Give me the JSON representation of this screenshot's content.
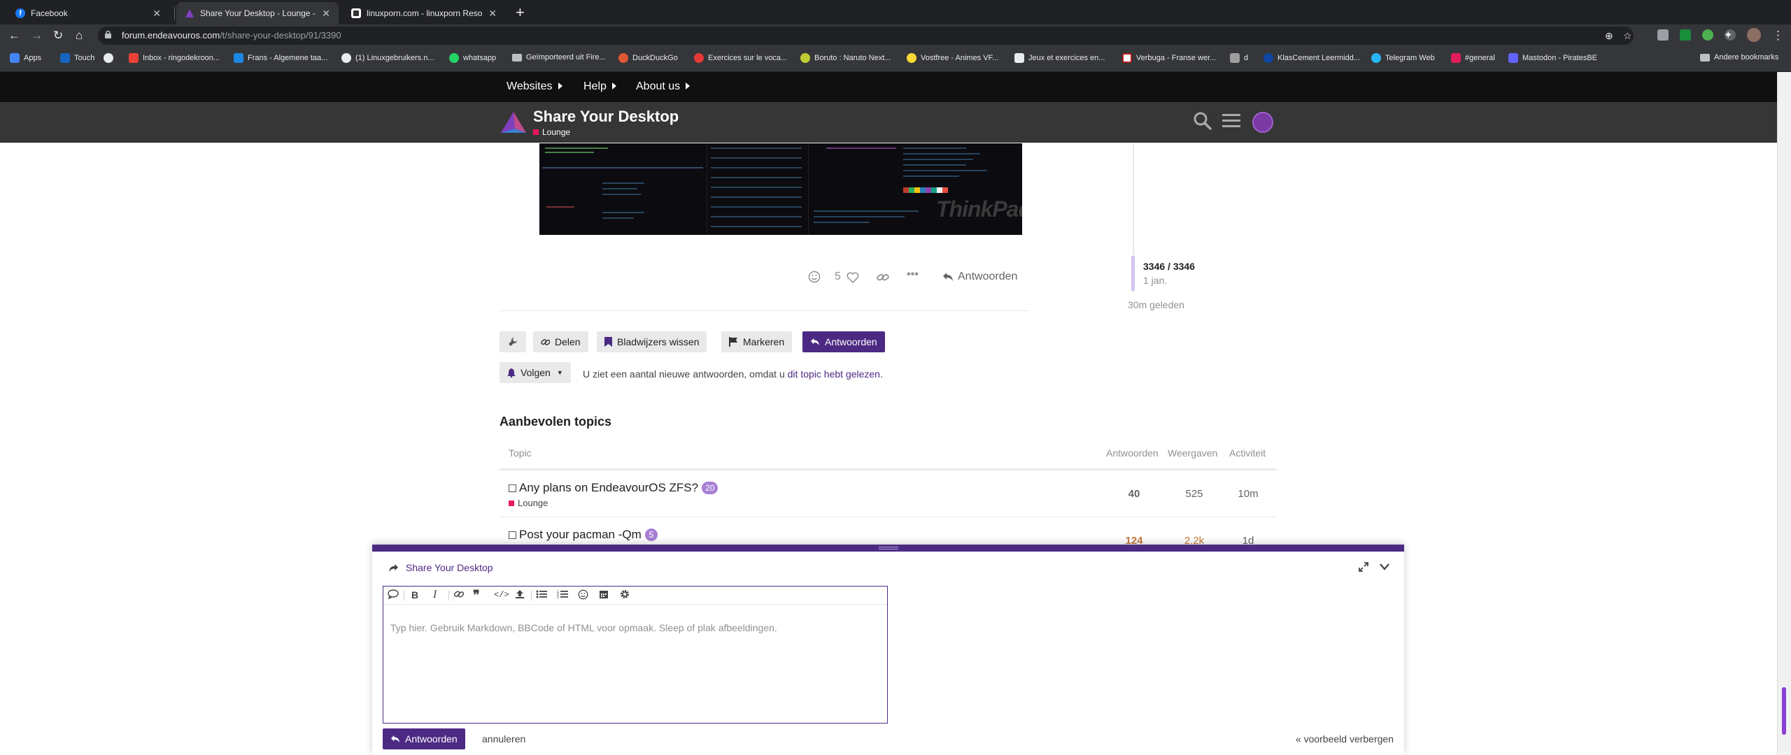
{
  "browser": {
    "tabs": [
      {
        "title": "Facebook",
        "active": false
      },
      {
        "title": "Share Your Desktop - Lounge - End",
        "active": true
      },
      {
        "title": "linuxporn.com - linuxporn Resource",
        "active": false
      }
    ],
    "url_domain": "forum.endeavouros.com",
    "url_path": "/t/share-your-desktop/91/3390",
    "bookmarks": [
      "Apps",
      "Touch",
      "",
      "Inbox - ringodekroon...",
      "Frans - Algemene taa...",
      "(1) Linuxgebruikers.n...",
      "whatsapp",
      "Geïmporteerd uit Fire...",
      "DuckDuckGo",
      "Exercices sur le voca...",
      "Boruto : Naruto Next...",
      "Vostfree - Animes VF...",
      "Jeux et exercices en...",
      "Verbuga - Franse wer...",
      "d",
      "KlasCement Leermidd...",
      "Telegram Web",
      "#general",
      "Mastodon - PiratesBE"
    ],
    "other_bookmarks": "Andere bookmarks"
  },
  "site": {
    "nav": [
      "Websites",
      "Help",
      "About us"
    ],
    "title": "Share Your Desktop",
    "category": "Lounge"
  },
  "post": {
    "likes": "5",
    "reply_label": "Antwoorden",
    "image_watermark": "ThinkPad"
  },
  "timeline": {
    "count": "3346 / 3346",
    "date": "1 jan.",
    "ago": "30m geleden"
  },
  "footer_buttons": {
    "share": "Delen",
    "bookmarks": "Bladwijzers wissen",
    "flag": "Markeren",
    "reply": "Antwoorden"
  },
  "notifications": {
    "button": "Volgen",
    "text_prefix": "U ziet een aantal nieuwe antwoorden, omdat u ",
    "link": "dit topic hebt gelezen",
    "text_suffix": "."
  },
  "suggested": {
    "title": "Aanbevolen topics",
    "headers": {
      "topic": "Topic",
      "replies": "Antwoorden",
      "views": "Weergaven",
      "activity": "Activiteit"
    },
    "rows": [
      {
        "title": "Any plans on EndeavourOS ZFS?",
        "badge": "20",
        "category": "Lounge",
        "replies": "40",
        "views": "525",
        "activity": "10m"
      },
      {
        "title": "Post your pacman -Qm",
        "badge": "5",
        "category": "",
        "replies": "124",
        "views": "2.2k",
        "activity": "1d"
      }
    ]
  },
  "composer": {
    "title": "Share Your Desktop",
    "placeholder": "Typ hier. Gebruik Markdown, BBCode of HTML voor opmaak. Sleep of plak afbeeldingen.",
    "submit": "Antwoorden",
    "cancel": "annuleren",
    "hide_preview": "« voorbeeld verbergen"
  },
  "colors": {
    "accent": "#4c2a84",
    "category": "#e9175b",
    "badge": "#a87fd4"
  }
}
